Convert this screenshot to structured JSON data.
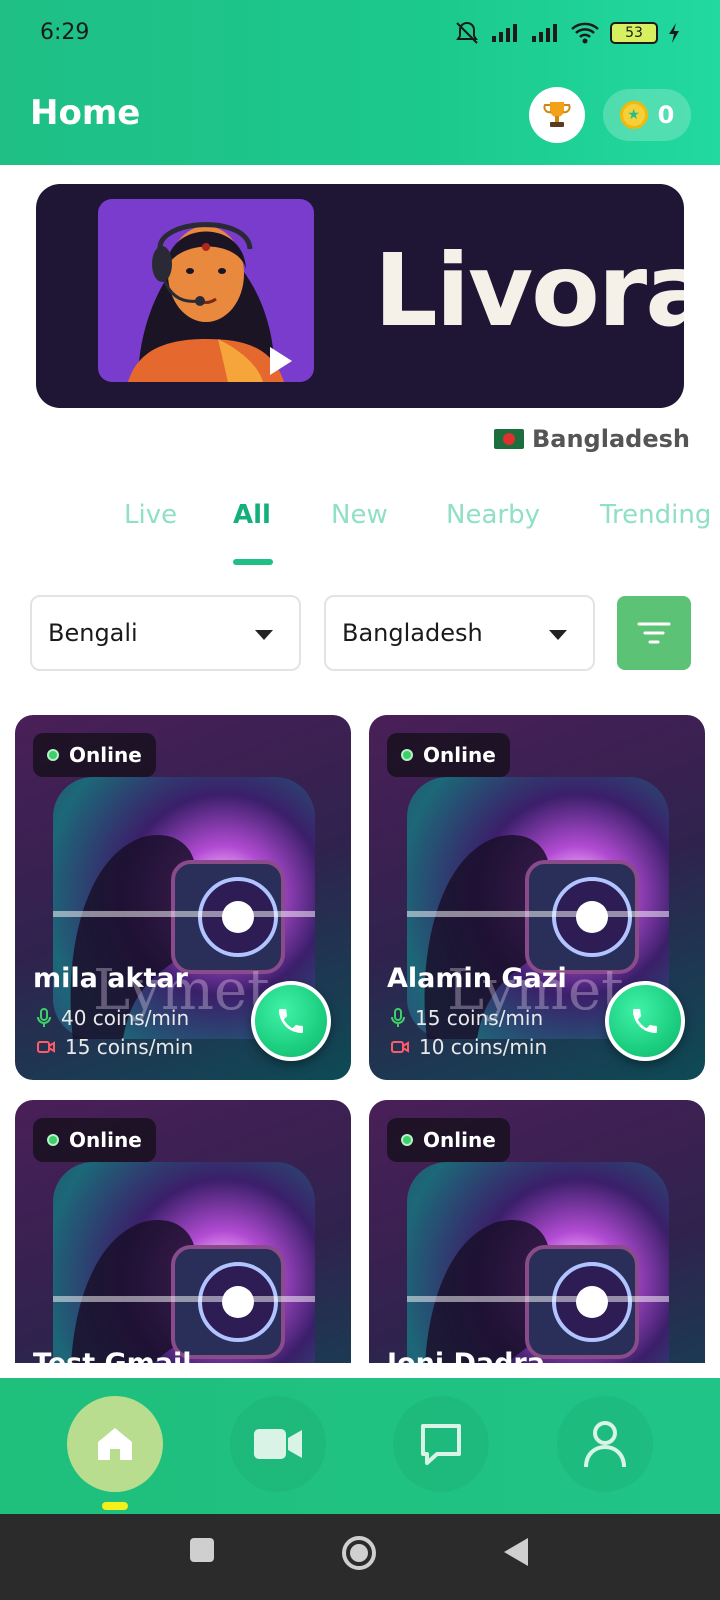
{
  "status_bar": {
    "time": "6:29",
    "battery": "53"
  },
  "header": {
    "title": "Home",
    "coins": "0",
    "trophy_icon": "trophy-icon",
    "coin_icon": "star-coin-icon"
  },
  "banner": {
    "title": "Livora"
  },
  "country_tag": {
    "label": "Bangladesh"
  },
  "tabs": [
    {
      "label": "Live"
    },
    {
      "label": "All",
      "active": true
    },
    {
      "label": "New"
    },
    {
      "label": "Nearby"
    },
    {
      "label": "Trending"
    }
  ],
  "filters": {
    "language": "Bengali",
    "country": "Bangladesh"
  },
  "cards": [
    {
      "status": "Online",
      "name": "mila aktar",
      "audio_rate": "40 coins/min",
      "video_rate": "15 coins/min"
    },
    {
      "status": "Online",
      "name": "Alamin Gazi",
      "audio_rate": "15 coins/min",
      "video_rate": "10 coins/min"
    },
    {
      "status": "Online",
      "name": "Test Gmail"
    },
    {
      "status": "Online",
      "name": "Joni Dadra"
    }
  ],
  "colors": {
    "accent": "#1fbf86",
    "filter_button": "#5cc276",
    "nav_active": "#b8dd8f"
  },
  "bottom_nav": [
    "home-icon",
    "video-icon",
    "chat-icon",
    "profile-icon"
  ]
}
